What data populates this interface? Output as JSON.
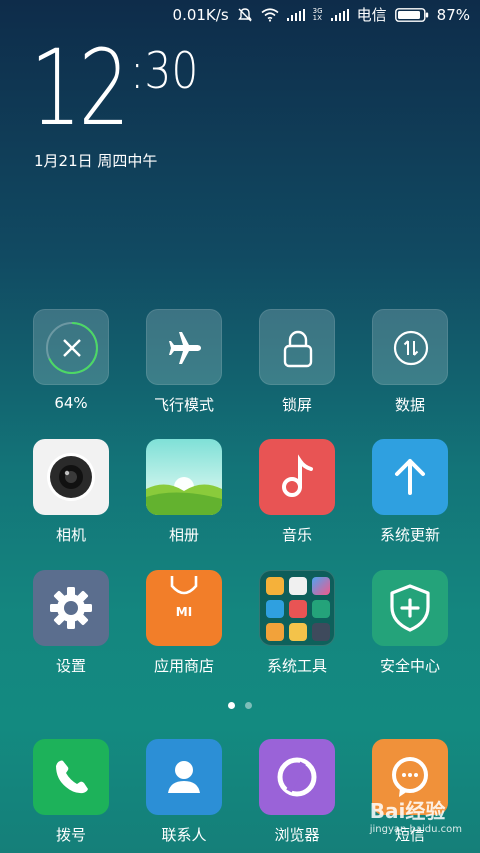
{
  "status_bar": {
    "speed": "0.01K/s",
    "network_badge": "3G 1X",
    "carrier": "电信",
    "battery": "87%"
  },
  "lockclock": {
    "hours": "12",
    "minutes": "30",
    "date": "1月21日 周四中午"
  },
  "rows": [
    [
      {
        "label": "64%"
      },
      {
        "label": "飞行模式"
      },
      {
        "label": "锁屏"
      },
      {
        "label": "数据"
      }
    ],
    [
      {
        "label": "相机"
      },
      {
        "label": "相册"
      },
      {
        "label": "音乐"
      },
      {
        "label": "系统更新"
      }
    ],
    [
      {
        "label": "设置"
      },
      {
        "label": "应用商店"
      },
      {
        "label": "系统工具"
      },
      {
        "label": "安全中心"
      }
    ]
  ],
  "dock": [
    {
      "label": "拨号"
    },
    {
      "label": "联系人"
    },
    {
      "label": "浏览器"
    },
    {
      "label": "短信"
    }
  ],
  "store_logo": "MI",
  "watermark": {
    "text": "Bai经验",
    "sub": "jingyan.baidu.com"
  },
  "colors": {
    "dialer": "#1db25a",
    "contacts": "#2c8fd6",
    "browser": "#9a63d8",
    "sms": "#f0913a",
    "store": "#f27e29",
    "security": "#24a37a",
    "update": "#2fa0e0",
    "music": "#e85454",
    "settings": "#5b6e8e"
  }
}
